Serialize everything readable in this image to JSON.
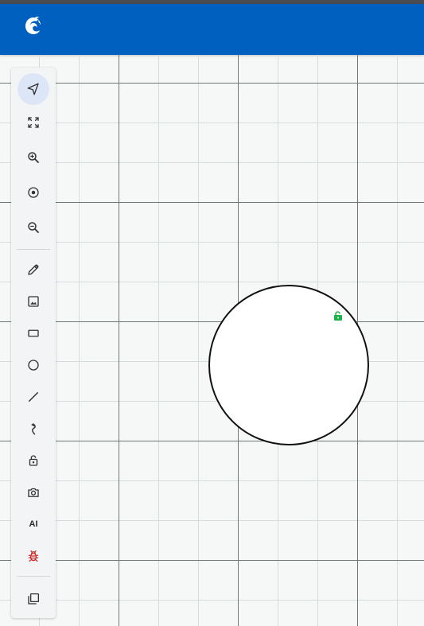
{
  "app": {
    "logo_icon": "chameleon-logo-icon",
    "brand_color": "#0060bf"
  },
  "toolbar": {
    "tools": [
      {
        "name": "select-tool",
        "icon": "navigation-arrow-icon",
        "active": true
      },
      {
        "name": "fit-to-screen-tool",
        "icon": "fit-screen-icon"
      },
      {
        "name": "zoom-in-tool",
        "icon": "zoom-in-icon"
      },
      {
        "name": "center-tool",
        "icon": "target-icon"
      },
      {
        "name": "zoom-out-tool",
        "icon": "zoom-out-icon"
      },
      {
        "name": "pencil-tool",
        "icon": "pencil-icon"
      },
      {
        "name": "image-tool",
        "icon": "image-icon"
      },
      {
        "name": "rectangle-tool",
        "icon": "rectangle-icon"
      },
      {
        "name": "circle-tool",
        "icon": "circle-icon"
      },
      {
        "name": "line-tool",
        "icon": "line-icon"
      },
      {
        "name": "curve-tool",
        "icon": "curve-arrow-icon"
      },
      {
        "name": "lock-tool",
        "icon": "lock-open-icon"
      },
      {
        "name": "screenshot-tool",
        "icon": "camera-icon"
      },
      {
        "name": "ai-tool",
        "label": "AI"
      },
      {
        "name": "debug-tool",
        "icon": "bug-icon",
        "color": "#c62828"
      },
      {
        "name": "copy-tool",
        "icon": "copy-icon"
      }
    ]
  },
  "canvas": {
    "shape_type": "circle",
    "lock_color": "#1fb24a",
    "grid_minor_color": "#d7dddc",
    "grid_major_color": "#6f7a76"
  }
}
